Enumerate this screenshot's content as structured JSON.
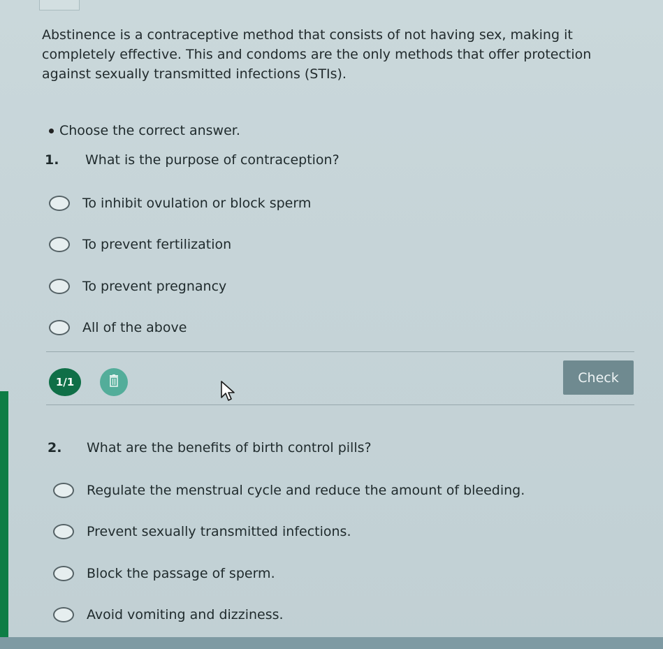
{
  "intro_text": "Abstinence is a contraceptive method that consists of not having sex, making it completely effective. This and condoms are the only methods that offer protection against sexually transmitted infections (STIs).",
  "instruction": "Choose the correct answer.",
  "questions": [
    {
      "number": "1.",
      "text": "What is the purpose of contraception?",
      "options": [
        "To inhibit ovulation or block sperm",
        "To prevent fertilization",
        "To prevent pregnancy",
        "All of the above"
      ]
    },
    {
      "number": "2.",
      "text": "What are the benefits of birth control pills?",
      "options": [
        "Regulate the menstrual cycle and reduce the amount of bleeding.",
        "Prevent sexually transmitted infections.",
        "Block the passage of sperm.",
        "Avoid vomiting and dizziness."
      ]
    }
  ],
  "toolbar": {
    "attempts": "1/1",
    "check_label": "Check",
    "delete_icon": "trash-icon",
    "cursor_icon": "mouse-pointer-icon"
  },
  "colors": {
    "attempt_badge": "#0f6f47",
    "delete_button": "#53ad9a",
    "check_button": "#6f8a90",
    "side_edge": "#0e7d45"
  }
}
